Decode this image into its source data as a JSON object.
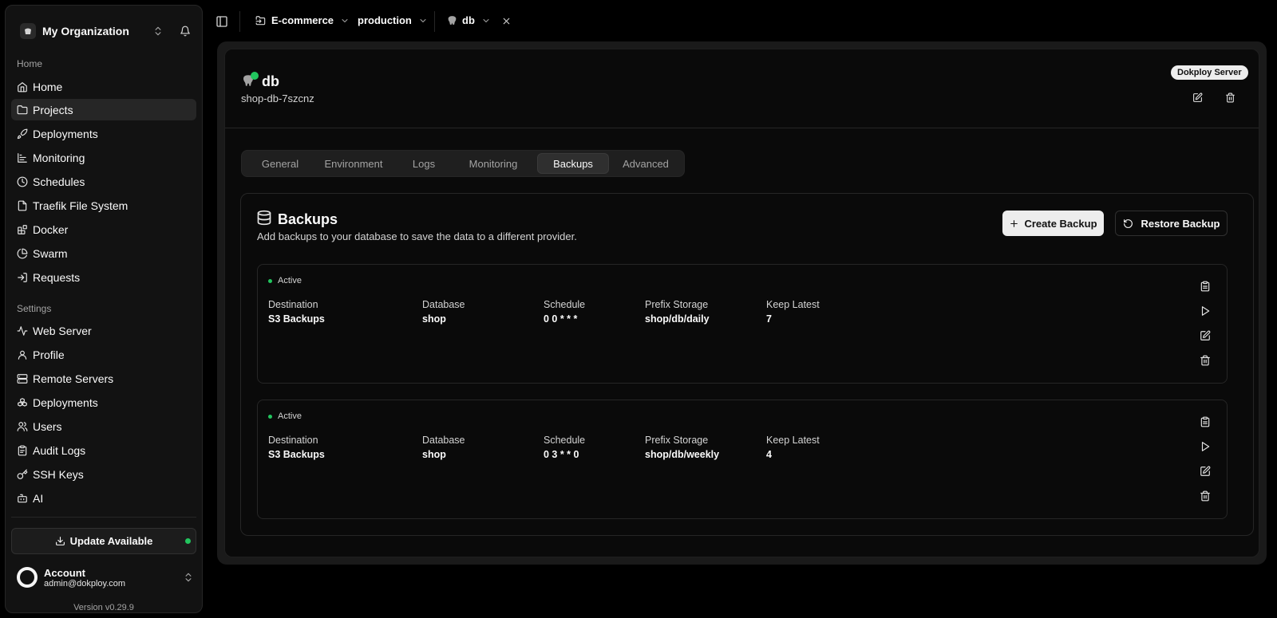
{
  "sidebar": {
    "org_name": "My Organization",
    "home_group_label": "Home",
    "settings_group_label": "Settings",
    "home_items": [
      {
        "label": "Home",
        "icon": "home-icon"
      },
      {
        "label": "Projects",
        "icon": "folder-icon",
        "active": true
      },
      {
        "label": "Deployments",
        "icon": "rocket-icon"
      },
      {
        "label": "Monitoring",
        "icon": "chart-icon"
      },
      {
        "label": "Schedules",
        "icon": "clock-icon"
      },
      {
        "label": "Traefik File System",
        "icon": "file-icon"
      },
      {
        "label": "Docker",
        "icon": "blocks-icon"
      },
      {
        "label": "Swarm",
        "icon": "pie-icon"
      },
      {
        "label": "Requests",
        "icon": "arrow-in-icon"
      }
    ],
    "settings_items": [
      {
        "label": "Web Server",
        "icon": "activity-icon"
      },
      {
        "label": "Profile",
        "icon": "user-icon"
      },
      {
        "label": "Remote Servers",
        "icon": "server-icon"
      },
      {
        "label": "Deployments",
        "icon": "boxes-icon"
      },
      {
        "label": "Users",
        "icon": "users-icon"
      },
      {
        "label": "Audit Logs",
        "icon": "clipboard-icon"
      },
      {
        "label": "SSH Keys",
        "icon": "key-icon"
      },
      {
        "label": "AI",
        "icon": "bot-icon"
      }
    ],
    "update_label": "Update Available",
    "account_name": "Account",
    "account_email": "admin@dokploy.com",
    "version": "Version v0.29.9"
  },
  "topbar": {
    "project": "E-commerce",
    "environment": "production",
    "service": "db"
  },
  "service": {
    "name": "db",
    "app_name": "shop-db-7szcnz",
    "server_badge": "Dokploy Server"
  },
  "tabs": [
    "General",
    "Environment",
    "Logs",
    "Monitoring",
    "Backups",
    "Advanced"
  ],
  "active_tab": "Backups",
  "backups": {
    "title": "Backups",
    "description": "Add backups to your database to save the data to a different provider.",
    "create_label": "Create Backup",
    "restore_label": "Restore Backup",
    "columns": {
      "destination": "Destination",
      "database": "Database",
      "schedule": "Schedule",
      "prefix": "Prefix Storage",
      "keep": "Keep Latest"
    },
    "items": [
      {
        "status": "Active",
        "destination": "S3 Backups",
        "database": "shop",
        "schedule": "0 0 * * *",
        "prefix": "shop/db/daily",
        "keep": "7"
      },
      {
        "status": "Active",
        "destination": "S3 Backups",
        "database": "shop",
        "schedule": "0 3 * * 0",
        "prefix": "shop/db/weekly",
        "keep": "4"
      }
    ]
  },
  "colors": {
    "accent_green": "#22c55e",
    "background": "#000000",
    "panel": "#0a0a0a"
  }
}
